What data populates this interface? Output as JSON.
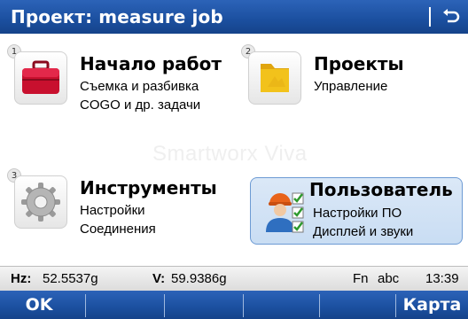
{
  "title": "Проект: measure job",
  "tiles": [
    {
      "num": "1",
      "title": "Начало работ",
      "line1": "Съемка и разбивка",
      "line2": "COGO и др. задачи",
      "icon": "briefcase-icon"
    },
    {
      "num": "2",
      "title": "Проекты",
      "line1": "Управление",
      "line2": "",
      "icon": "folder-icon"
    },
    {
      "num": "3",
      "title": "Инструменты",
      "line1": "Настройки",
      "line2": "Соединения",
      "icon": "gear-icon"
    },
    {
      "num": "",
      "title": "Пользователь",
      "line1": "Настройки ПО",
      "line2": "Дисплей и звуки",
      "icon": "user-settings-icon"
    }
  ],
  "watermark": "Smartworx Viva",
  "status": {
    "hz_label": "Hz:",
    "hz_value": "52.5537g",
    "v_label": "V:",
    "v_value": "59.9386g",
    "fn": "Fn",
    "abc": "abc",
    "time": "13:39"
  },
  "softkeys": {
    "ok": "OK",
    "map": "Карта"
  },
  "colors": {
    "bar_blue": "#1b4f9f",
    "selected_tile": "#c9ddf3",
    "briefcase_red": "#c8102e",
    "folder_yellow": "#f2c21b"
  }
}
